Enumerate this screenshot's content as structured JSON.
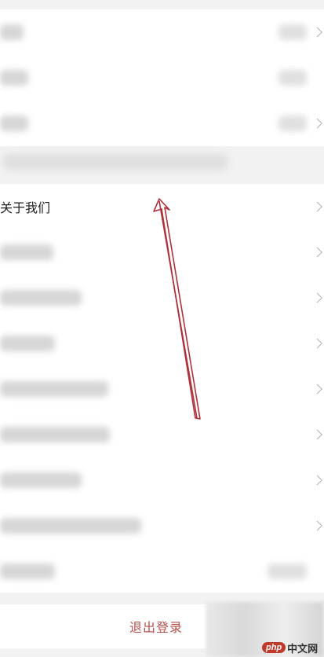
{
  "settings": {
    "about_label": "关于我们",
    "logout_label": "退出登录"
  },
  "watermark": {
    "badge": "php",
    "site": "中文网"
  },
  "annotation_color": "#b0303a"
}
